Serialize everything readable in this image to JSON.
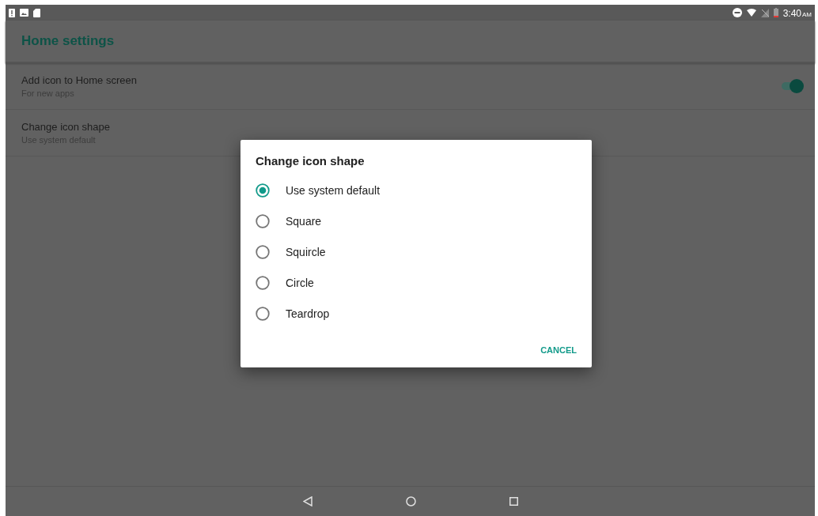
{
  "status_bar": {
    "time": "3:40",
    "ampm": "AM"
  },
  "toolbar": {
    "title": "Home settings"
  },
  "settings": [
    {
      "kind": "switch",
      "title": "Add icon to Home screen",
      "summary": "For new apps",
      "on": true
    },
    {
      "kind": "plain",
      "title": "Change icon shape",
      "summary": "Use system default"
    }
  ],
  "dialog": {
    "title": "Change icon shape",
    "options": [
      {
        "label": "Use system default",
        "selected": true
      },
      {
        "label": "Square",
        "selected": false
      },
      {
        "label": "Squircle",
        "selected": false
      },
      {
        "label": "Circle",
        "selected": false
      },
      {
        "label": "Teardrop",
        "selected": false
      }
    ],
    "button": "CANCEL"
  }
}
